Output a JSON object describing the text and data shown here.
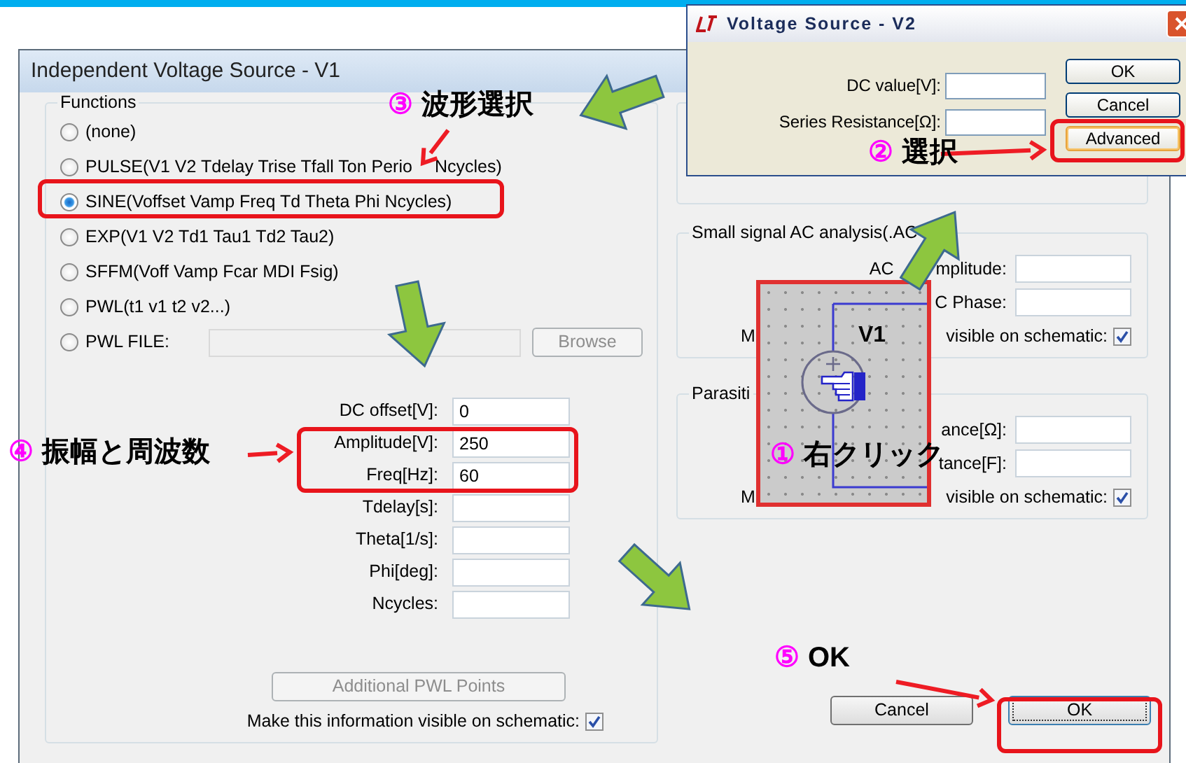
{
  "main_dialog": {
    "title": "Independent Voltage Source - V1",
    "functions": {
      "legend": "Functions",
      "options": [
        {
          "label": "(none)",
          "selected": false
        },
        {
          "label": "PULSE(V1 V2 Tdelay Trise Tfall Ton Perio",
          "label_end": "Ncycles)",
          "selected": false
        },
        {
          "label": "SINE(Voffset Vamp Freq Td Theta Phi Ncycles)",
          "selected": true
        },
        {
          "label": "EXP(V1 V2 Td1 Tau1 Td2 Tau2)",
          "selected": false
        },
        {
          "label": "SFFM(Voff Vamp Fcar MDI Fsig)",
          "selected": false
        },
        {
          "label": "PWL(t1 v1 t2 v2...)",
          "selected": false
        },
        {
          "label": "PWL FILE:",
          "selected": false,
          "kind": "file",
          "field": {
            "disabled": true
          },
          "browse_button": {
            "label": "Browse",
            "disabled": true
          }
        }
      ]
    },
    "parameters": [
      {
        "label": "DC offset[V]:",
        "value": "0"
      },
      {
        "label": "Amplitude[V]:",
        "value": "250"
      },
      {
        "label": "Freq[Hz]:",
        "value": "60"
      },
      {
        "label": "Tdelay[s]:"
      },
      {
        "label": "Theta[1/s]:"
      },
      {
        "label": "Phi[deg]:"
      },
      {
        "label": "Ncycles:"
      }
    ],
    "additional_points_button": {
      "label": "Additional PWL Points",
      "disabled": true
    },
    "visible_on_schematic": {
      "label": "Make this information visible on schematic:",
      "checked": true
    },
    "right_groups": [
      {
        "title": "Small signal AC analysis(.AC",
        "fields": [
          {
            "prefix": "AC",
            "label": "mplitude:"
          },
          {
            "label": "C Phase:"
          }
        ],
        "visible_row": {
          "start": "M",
          "end": "visible on schematic:",
          "checked": true
        }
      },
      {
        "title": "Parasiti",
        "fields": [
          {
            "label": "ance[Ω]:"
          },
          {
            "label": "tance[F]:"
          }
        ],
        "visible_row": {
          "start": "M",
          "end": "visible on schematic:",
          "checked": true
        }
      }
    ],
    "buttons": [
      {
        "label": "Cancel",
        "default": false
      },
      {
        "label": "OK",
        "default": true
      }
    ]
  },
  "v2_dialog": {
    "title": "Voltage Source - V2",
    "fields": [
      {
        "label": "DC value[V]:"
      },
      {
        "label": "Series Resistance[Ω]:"
      }
    ],
    "buttons": [
      {
        "label": "OK",
        "focused": false
      },
      {
        "label": "Cancel",
        "focused": false
      },
      {
        "label": "Advanced",
        "focused": true
      }
    ]
  },
  "schematic_inset": {
    "label": "V1"
  },
  "annotations": [
    {
      "number": "③",
      "text": "波形選択"
    },
    {
      "number": "②",
      "text": "選択"
    },
    {
      "number": "④",
      "text": "振幅と周波数"
    },
    {
      "number": "①",
      "text": "右クリック"
    },
    {
      "number": "⑤",
      "text": "OK"
    }
  ]
}
